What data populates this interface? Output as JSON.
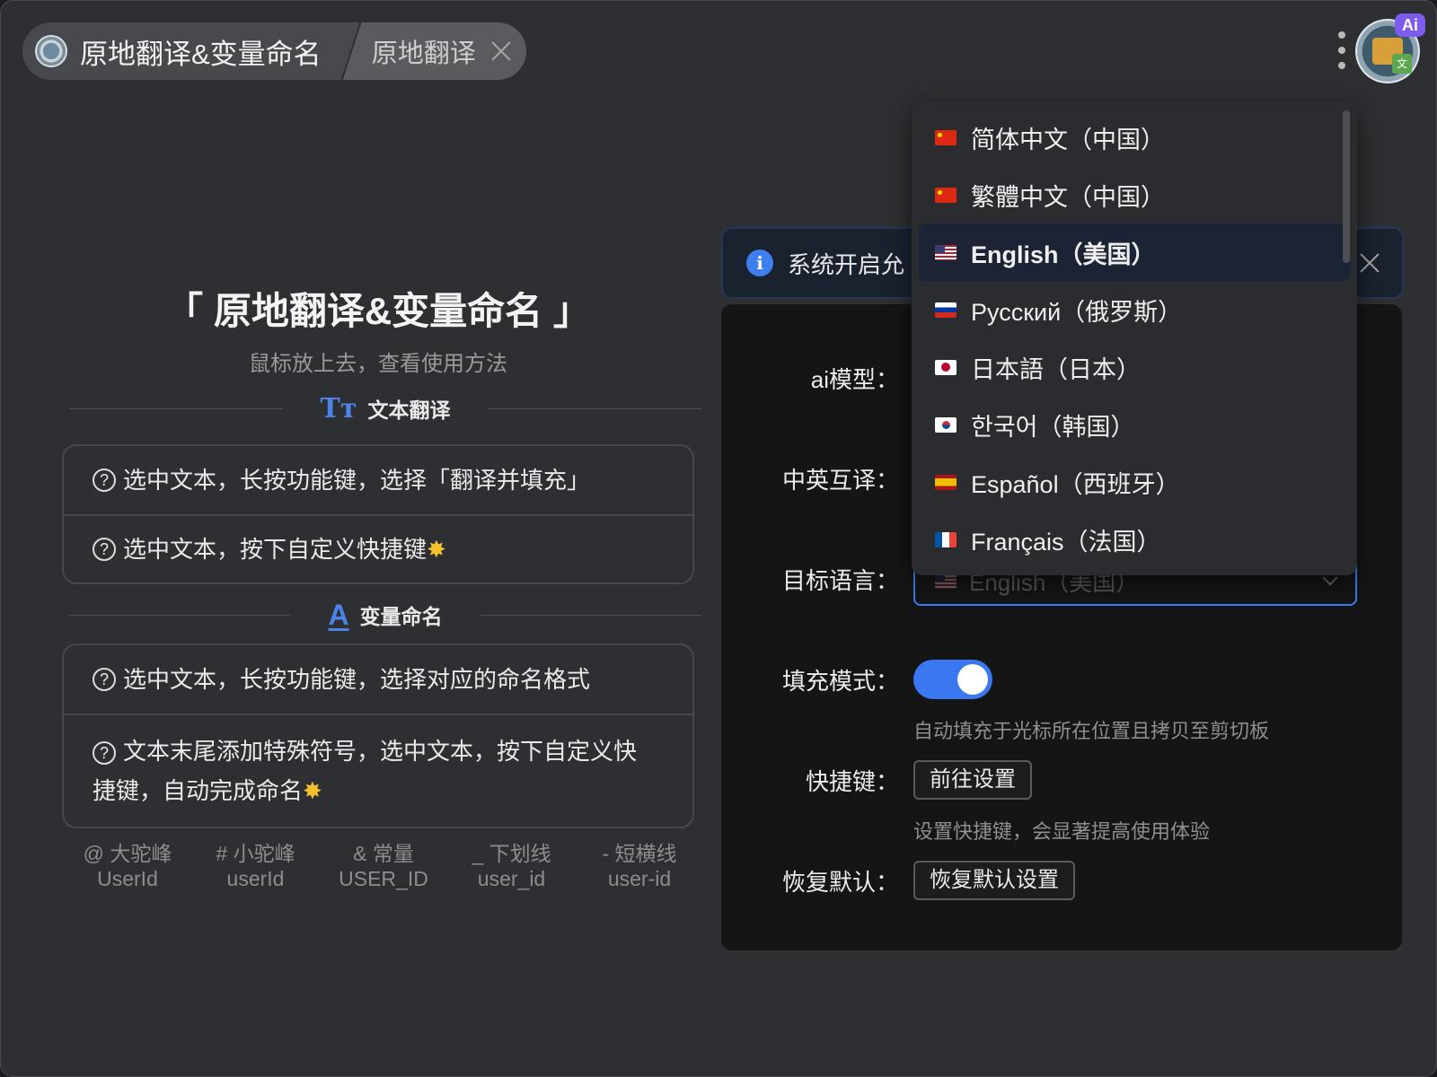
{
  "tabs": {
    "main_label": "原地翻译&变量命名",
    "sub_label": "原地翻译"
  },
  "header": {
    "ai_badge": "Ai"
  },
  "hero": {
    "title": "「 原地翻译&变量命名 」",
    "subtitle": "鼠标放上去，查看使用方法"
  },
  "sections": {
    "text_translate": {
      "icon": "Tт",
      "title": "文本翻译",
      "items": [
        "选中文本，长按功能键，选择「翻译并填充」",
        "选中文本，按下自定义快捷键"
      ]
    },
    "var_naming": {
      "icon": "A",
      "title": "变量命名",
      "items": [
        "选中文本，长按功能键，选择对应的命名格式",
        "文本末尾添加特殊符号，选中文本，按下自定义快捷键，自动完成命名"
      ]
    }
  },
  "formats": [
    {
      "symbol": "@ 大驼峰",
      "example": "UserId"
    },
    {
      "symbol": "# 小驼峰",
      "example": "userId"
    },
    {
      "symbol": "& 常量",
      "example": "USER_ID"
    },
    {
      "symbol": "_ 下划线",
      "example": "user_id"
    },
    {
      "symbol": "- 短横线",
      "example": "user-id"
    }
  ],
  "alert": {
    "text": "系统开启允"
  },
  "form": {
    "ai_model_label": "ai模型：",
    "zh_en_label": "中英互译：",
    "target_lang_label": "目标语言：",
    "target_lang_value": "English（美国）",
    "fill_mode_label": "填充模式：",
    "fill_mode_on": true,
    "fill_mode_hint": "自动填充于光标所在位置且拷贝至剪切板",
    "shortcut_label": "快捷键：",
    "shortcut_button": "前往设置",
    "shortcut_hint": "设置快捷键，会显著提高使用体验",
    "reset_label": "恢复默认：",
    "reset_button": "恢复默认设置"
  },
  "dropdown": {
    "selected_index": 2,
    "options": [
      {
        "label": "简体中文（中国）",
        "flag": "cn"
      },
      {
        "label": "繁體中文（中国）",
        "flag": "cn"
      },
      {
        "label": "English（美国）",
        "flag": "us"
      },
      {
        "label": "Русский（俄罗斯）",
        "flag": "ru"
      },
      {
        "label": "日本語（日本）",
        "flag": "jp"
      },
      {
        "label": "한국어（韩国）",
        "flag": "kr"
      },
      {
        "label": "Español（西班牙）",
        "flag": "es"
      },
      {
        "label": "Français（法国）",
        "flag": "fr"
      }
    ]
  },
  "colors": {
    "accent": "#3978f0",
    "star": "#f4c02e",
    "ai_badge": "#7e5bef"
  }
}
